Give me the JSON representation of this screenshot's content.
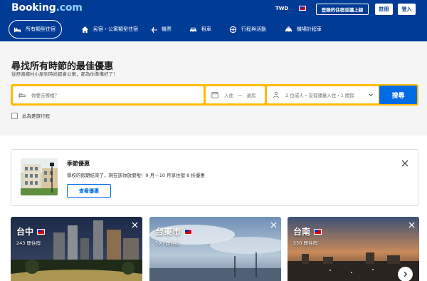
{
  "header": {
    "logo_main": "Booking",
    "logo_tld": ".com",
    "currency": "TWD",
    "list_property_label": "登錄的住宿並議上線",
    "register_label": "註冊",
    "login_label": "登入"
  },
  "nav": {
    "items": [
      {
        "label": "所有類型住宿",
        "icon": "bed-icon"
      },
      {
        "label": "民宿・公寓類型住宿",
        "icon": "house-icon"
      },
      {
        "label": "機票",
        "icon": "plane-icon"
      },
      {
        "label": "租車",
        "icon": "car-icon"
      },
      {
        "label": "行程與活動",
        "icon": "attractions-icon"
      },
      {
        "label": "機場計程車",
        "icon": "taxi-icon"
      }
    ]
  },
  "hero": {
    "title": "尋找所有時節的最佳優惠",
    "subtitle": "從舒適鄉村小屋到時尚都會公寓，都為你準備好了！"
  },
  "search": {
    "destination_placeholder": "你要去哪裡？",
    "checkin_label": "入住",
    "checkout_label": "退房",
    "date_separator": "—",
    "guests_label": "2 位成人・沒有隨童入住・1 間房",
    "search_label": "搜尋",
    "business_trip_label": "此為差旅行程"
  },
  "promo": {
    "title": "季節優惠",
    "description": "學校的假期結束了，現在該你放假啦！9 月－10 月享住宿 8 折優惠",
    "button_label": "查看優惠"
  },
  "destinations": [
    {
      "name": "台中",
      "count": "243 間住宿"
    },
    {
      "name": "台東市",
      "count": "590 間住宿"
    },
    {
      "name": "台南",
      "count": "550 間住宿"
    }
  ],
  "colors": {
    "brand_blue": "#003b95",
    "search_yellow": "#febb02",
    "action_blue": "#006ce4"
  }
}
